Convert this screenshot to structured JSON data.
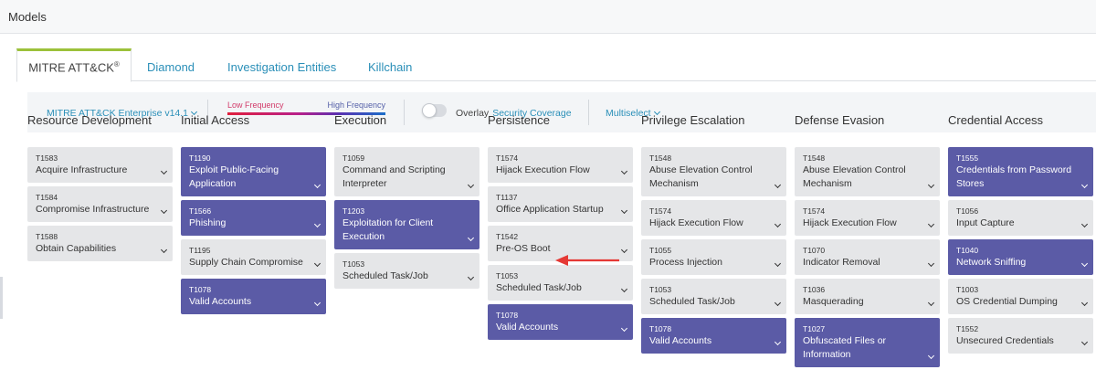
{
  "header": {
    "title": "Models"
  },
  "tabs": [
    {
      "label": "MITRE ATT&CK",
      "sup": "®"
    },
    {
      "label": "Diamond"
    },
    {
      "label": "Investigation Entities"
    },
    {
      "label": "Killchain"
    }
  ],
  "toolbar": {
    "framework": "MITRE ATT&CK Enterprise v14.1",
    "low_label": "Low Frequency",
    "high_label": "High Frequency",
    "overlay_label": "Overlay",
    "overlay_link": "Security Coverage",
    "overlay_on": false,
    "multiselect": "Multiselect"
  },
  "colors": {
    "highlight": "#5b5ba6",
    "card": "#e5e6e8",
    "link": "#2a8fb8",
    "active_tab": "#9cc13a",
    "arrow": "#e53935"
  },
  "columns": [
    {
      "title": "Resource Development",
      "cards": [
        {
          "id": "T1583",
          "name": "Acquire Infrastructure",
          "hl": false
        },
        {
          "id": "T1584",
          "name": "Compromise Infrastructure",
          "hl": false
        },
        {
          "id": "T1588",
          "name": "Obtain Capabilities",
          "hl": false
        }
      ]
    },
    {
      "title": "Initial Access",
      "cards": [
        {
          "id": "T1190",
          "name": "Exploit Public-Facing Application",
          "hl": true
        },
        {
          "id": "T1566",
          "name": "Phishing",
          "hl": true
        },
        {
          "id": "T1195",
          "name": "Supply Chain Compromise",
          "hl": false
        },
        {
          "id": "T1078",
          "name": "Valid Accounts",
          "hl": true
        }
      ]
    },
    {
      "title": "Execution",
      "cards": [
        {
          "id": "T1059",
          "name": "Command and Scripting Interpreter",
          "hl": false
        },
        {
          "id": "T1203",
          "name": "Exploitation for Client Execution",
          "hl": true
        },
        {
          "id": "T1053",
          "name": "Scheduled Task/Job",
          "hl": false
        }
      ]
    },
    {
      "title": "Persistence",
      "cards": [
        {
          "id": "T1574",
          "name": "Hijack Execution Flow",
          "hl": false
        },
        {
          "id": "T1137",
          "name": "Office Application Startup",
          "hl": false
        },
        {
          "id": "T1542",
          "name": "Pre-OS Boot",
          "hl": false
        },
        {
          "id": "T1053",
          "name": "Scheduled Task/Job",
          "hl": false
        },
        {
          "id": "T1078",
          "name": "Valid Accounts",
          "hl": true
        }
      ]
    },
    {
      "title": "Privilege Escalation",
      "cards": [
        {
          "id": "T1548",
          "name": "Abuse Elevation Control Mechanism",
          "hl": false
        },
        {
          "id": "T1574",
          "name": "Hijack Execution Flow",
          "hl": false
        },
        {
          "id": "T1055",
          "name": "Process Injection",
          "hl": false
        },
        {
          "id": "T1053",
          "name": "Scheduled Task/Job",
          "hl": false
        },
        {
          "id": "T1078",
          "name": "Valid Accounts",
          "hl": true
        }
      ]
    },
    {
      "title": "Defense Evasion",
      "cards": [
        {
          "id": "T1548",
          "name": "Abuse Elevation Control Mechanism",
          "hl": false
        },
        {
          "id": "T1574",
          "name": "Hijack Execution Flow",
          "hl": false
        },
        {
          "id": "T1070",
          "name": "Indicator Removal",
          "hl": false
        },
        {
          "id": "T1036",
          "name": "Masquerading",
          "hl": false
        },
        {
          "id": "T1027",
          "name": "Obfuscated Files or Information",
          "hl": true
        }
      ]
    },
    {
      "title": "Credential Access",
      "cards": [
        {
          "id": "T1555",
          "name": "Credentials from Password Stores",
          "hl": true
        },
        {
          "id": "T1056",
          "name": "Input Capture",
          "hl": false
        },
        {
          "id": "T1040",
          "name": "Network Sniffing",
          "hl": true
        },
        {
          "id": "T1003",
          "name": "OS Credential Dumping",
          "hl": false
        },
        {
          "id": "T1552",
          "name": "Unsecured Credentials",
          "hl": false
        }
      ]
    }
  ]
}
